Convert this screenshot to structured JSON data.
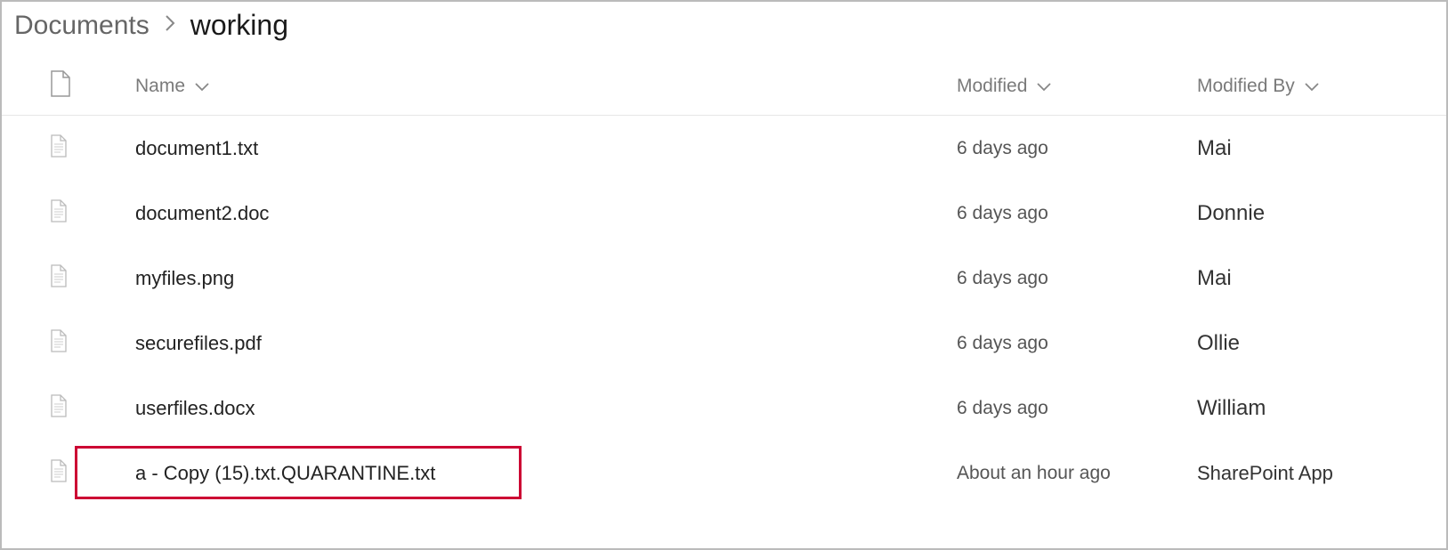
{
  "breadcrumb": {
    "root": "Documents",
    "current": "working"
  },
  "columns": {
    "name": "Name",
    "modified": "Modified",
    "modifiedBy": "Modified By"
  },
  "files": [
    {
      "icon": "file",
      "name": "document1.txt",
      "modified": "6 days ago",
      "modifiedBy": "Mai",
      "highlight": false
    },
    {
      "icon": "file",
      "name": "document2.doc",
      "modified": "6 days ago",
      "modifiedBy": "Donnie",
      "highlight": false
    },
    {
      "icon": "file",
      "name": "myfiles.png",
      "modified": "6 days ago",
      "modifiedBy": "Mai",
      "highlight": false
    },
    {
      "icon": "file",
      "name": "securefiles.pdf",
      "modified": "6 days ago",
      "modifiedBy": "Ollie",
      "highlight": false
    },
    {
      "icon": "file",
      "name": "userfiles.docx",
      "modified": "6 days ago",
      "modifiedBy": "William",
      "highlight": false
    },
    {
      "icon": "file",
      "name": "a - Copy (15).txt.QUARANTINE.txt",
      "modified": "About an hour ago",
      "modifiedBy": "SharePoint App",
      "highlight": true
    }
  ]
}
